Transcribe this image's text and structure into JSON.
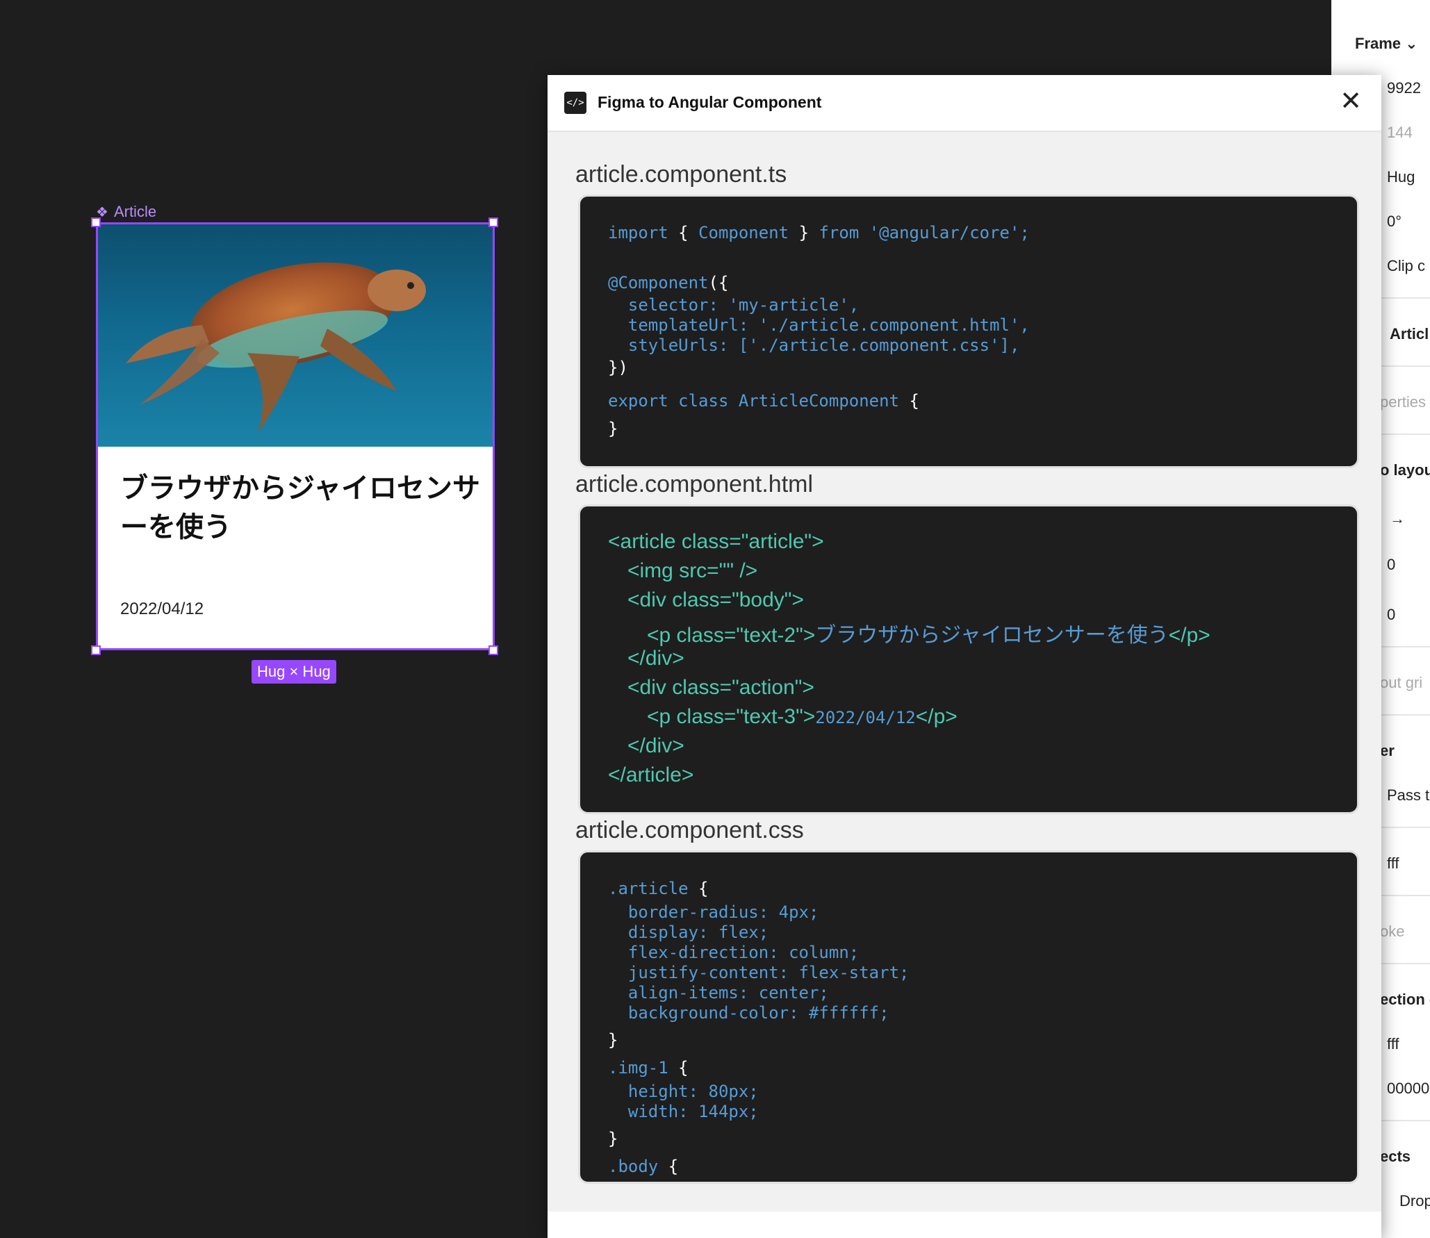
{
  "canvas": {
    "component_label": "Article",
    "card": {
      "title": "ブラウザからジャイロセンサーを使う",
      "date": "2022/04/12"
    },
    "size_badge": "Hug × Hug"
  },
  "plugin": {
    "title": "Figma to Angular Component",
    "icon_text": "</>",
    "files": [
      {
        "name": "article.component.ts"
      },
      {
        "name": "article.component.html"
      },
      {
        "name": "article.component.css"
      }
    ],
    "ts_code": {
      "l1_kw": "import",
      "l1_brace_open": "{",
      "l1_name": "Component",
      "l1_brace_close": "}",
      "l1_from": "from",
      "l1_src": "'@angular/core';",
      "l2_dec": "@Component",
      "l2_open": "({",
      "l3": "  selector: 'my-article',",
      "l4": "  templateUrl: './article.component.html',",
      "l5": "  styleUrls: ['./article.component.css'],",
      "l6": "})",
      "l7_kw": "export class ArticleComponent",
      "l7_brace": "{",
      "l8": "}"
    },
    "html_code": {
      "l1": "<article class=\"article\">",
      "l2": "<img src=\"\" />",
      "l3": "<div class=\"body\">",
      "l4_tag": "<p class=\"text-2\">",
      "l4_text": "ブラウザからジャイロセンサーを使う",
      "l4_close": "</p>",
      "l5": "</div>",
      "l6": "<div class=\"action\">",
      "l7_tag": "<p class=\"text-3\">",
      "l7_text": "2022/04/12",
      "l7_close": "</p>",
      "l8": "</div>",
      "l9": "</article>"
    },
    "css_code": {
      "l1_sel": ".article",
      "l1_brace": "{",
      "l2": "  border-radius: 4px;",
      "l3": "  display: flex;",
      "l4": "  flex-direction: column;",
      "l5": "  justify-content: flex-start;",
      "l6": "  align-items: center;",
      "l7": "  background-color: #ffffff;",
      "l8": "}",
      "l9_sel": ".img-1",
      "l9_brace": "{",
      "l10": "  height: 80px;",
      "l11": "  width: 144px;",
      "l12": "}",
      "l13_sel": ".body",
      "l13_brace": "{"
    }
  },
  "properties_panel": {
    "frame_label": "Frame",
    "x": "9922",
    "y": "144",
    "height_mode": "Hug",
    "rotation": "0°",
    "clip": "Clip c",
    "component_name": "Articl",
    "properties": "perties",
    "auto_layout": "o layou",
    "arrow": "→",
    "spacing1": "0",
    "spacing2": "0",
    "layout_grid": "out gri",
    "layer": "er",
    "pass_through": "Pass t",
    "fill1": "fff",
    "stroke": "oke",
    "selection_colors": "ection c",
    "fill2": "fff",
    "fill3": "00000",
    "effects": "ects",
    "drop": "Drop"
  }
}
